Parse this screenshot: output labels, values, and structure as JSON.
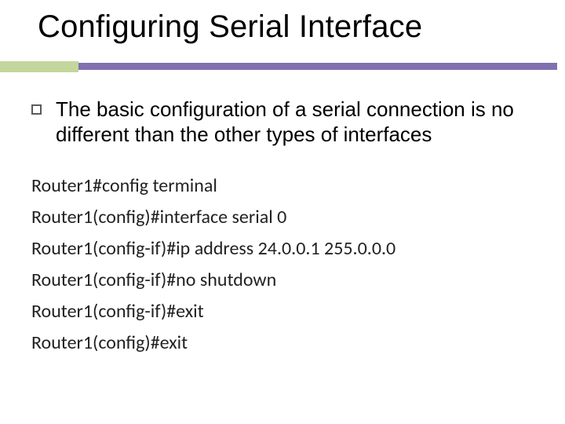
{
  "slide": {
    "title": "Configuring Serial Interface",
    "body": "The basic configuration of a serial connection is no different than the other types of interfaces",
    "code": {
      "l1": "Router1#config terminal",
      "l2": "Router1(config)#interface serial 0",
      "l3": "Router1(config-if)#ip address 24.0.0.1 255.0.0.0",
      "l4": "Router1(config-if)#no shutdown",
      "l5": "Router1(config-if)#exit",
      "l6": "Router1(config)#exit"
    }
  }
}
